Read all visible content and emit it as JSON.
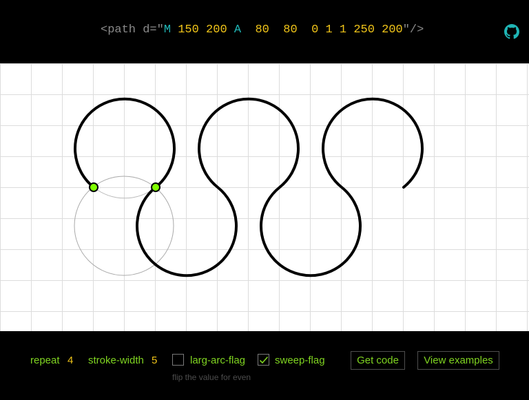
{
  "header": {
    "code": {
      "open": "<path d=\"",
      "move_cmd": "M",
      "move_x": "150",
      "move_y": "200",
      "arc_cmd": "A",
      "rx": "80",
      "ry": "80",
      "rotation": "0",
      "large_arc": "1",
      "sweep": "1",
      "end_x": "250",
      "end_y": "200",
      "close": "\"/>"
    },
    "github_icon": "github-icon"
  },
  "controls": {
    "repeat_label": "repeat",
    "repeat_value": "4",
    "stroke_label": "stroke-width",
    "stroke_value": "5",
    "large_arc_label": "larg-arc-flag",
    "large_arc_checked": false,
    "sweep_label": "sweep-flag",
    "sweep_checked": true,
    "hint": "flip the value for even",
    "get_code_label": "Get code",
    "view_examples_label": "View examples"
  },
  "colors": {
    "accent_green": "#7fd321",
    "number_yellow": "#f0c419",
    "command_teal": "#1fb5b5",
    "muted_gray": "#8a8a8a"
  }
}
